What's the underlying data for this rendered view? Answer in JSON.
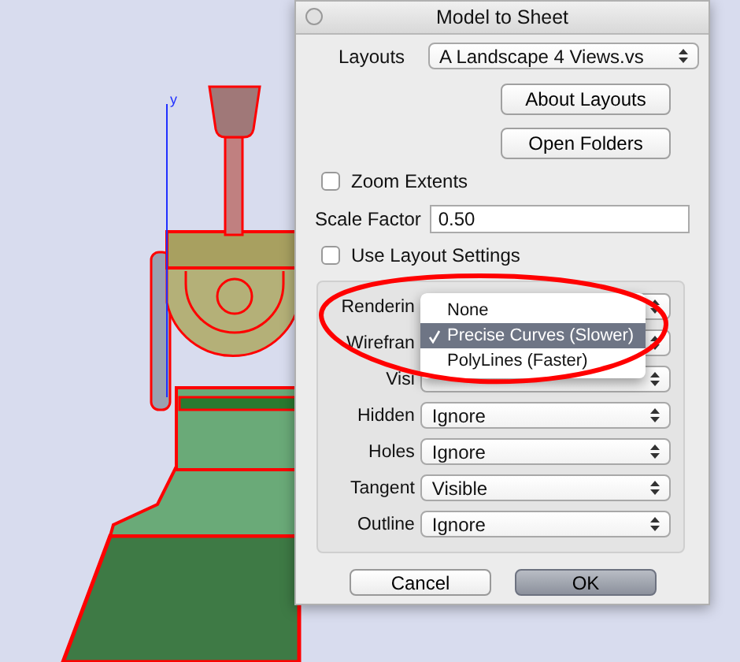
{
  "viewport": {
    "axis_label": "y"
  },
  "window": {
    "title": "Model to Sheet"
  },
  "layouts": {
    "label": "Layouts",
    "value": "A Landscape 4 Views.vs"
  },
  "buttons": [
    {
      "label": "About Layouts"
    },
    {
      "label": "Open Folders"
    }
  ],
  "zoom_extents": {
    "label": "Zoom Extents",
    "checked": false
  },
  "scale_factor": {
    "label": "Scale Factor",
    "value": "0.50"
  },
  "use_layout_settings": {
    "label": "Use Layout Settings",
    "checked": false
  },
  "settings": [
    {
      "label": "Renderin"
    },
    {
      "label": "Wirefran"
    },
    {
      "label": "Visi"
    },
    {
      "label": "Hidden",
      "value": "Ignore"
    },
    {
      "label": "Holes",
      "value": "Ignore"
    },
    {
      "label": "Tangent",
      "value": "Visible"
    },
    {
      "label": "Outline",
      "value": "Ignore"
    }
  ],
  "popup_menu": {
    "items": [
      {
        "label": "None",
        "selected": false
      },
      {
        "label": "Precise Curves (Slower)",
        "selected": true
      },
      {
        "label": "PolyLines (Faster)",
        "selected": false
      }
    ]
  },
  "footer_buttons": [
    {
      "label": "Cancel",
      "default": false
    },
    {
      "label": "OK",
      "default": true
    }
  ]
}
